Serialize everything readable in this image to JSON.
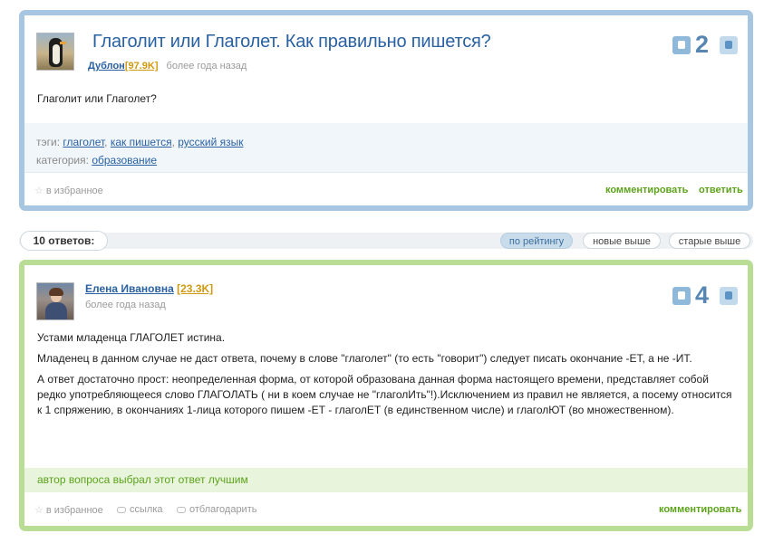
{
  "question": {
    "title": "Глаголит или Глаголет. Как правильно пишется?",
    "author": "Дублон",
    "rating": "[97.9K]",
    "time": "более года назад",
    "votes": "2",
    "body": "Глаголит или Глаголет?",
    "tags_label": "тэги:",
    "tags": [
      "глаголет",
      "как пишется",
      "русский язык"
    ],
    "category_label": "категория:",
    "category": "образование",
    "favorite_label": "в избранное",
    "comment_label": "комментировать",
    "reply_label": "ответить"
  },
  "answers_header": {
    "count_label": "10 ответов:",
    "sort_options": [
      "по рейтингу",
      "новые выше",
      "старые выше"
    ]
  },
  "answer": {
    "author": "Елена Ивановна",
    "rating": "[23.3K]",
    "time": "более года назад",
    "votes": "4",
    "paragraphs": [
      "Устами младенца ГЛАГОЛЕТ истина.",
      "Младенец в данном случае не даст ответа, почему в слове \"глаголет\" (то есть \"говорит\") следует писать окончание -ЕТ, а не -ИТ.",
      "А ответ достаточно прост: неопределенная форма, от которой образована данная форма настоящего времени, представляет собой редко употребляющееся слово ГЛАГОЛАТЬ ( ни в коем случае не \"глаголИть\"!).Исключением из правил не является, а посему относится к 1 спряжению, в окончаниях 1-лица которого пишем -ЕТ - глаголЕТ (в единственном числе) и глаголЮТ (во множественном)."
    ],
    "best_note": "автор вопроса выбрал этот ответ лучшим",
    "favorite_label": "в избранное",
    "link_label": "ссылка",
    "thank_label": "отблагодарить",
    "comment_label": "комментировать"
  },
  "colors": {
    "question_border": "#a6c6e2",
    "answer_border": "#b9dd95",
    "link": "#2a61a2",
    "action_green": "#5ca31b",
    "rating_gold": "#d09910"
  },
  "icons": [
    "thumbs-down-icon",
    "thumbs-up-icon",
    "star-icon",
    "link-icon",
    "gift-icon"
  ]
}
